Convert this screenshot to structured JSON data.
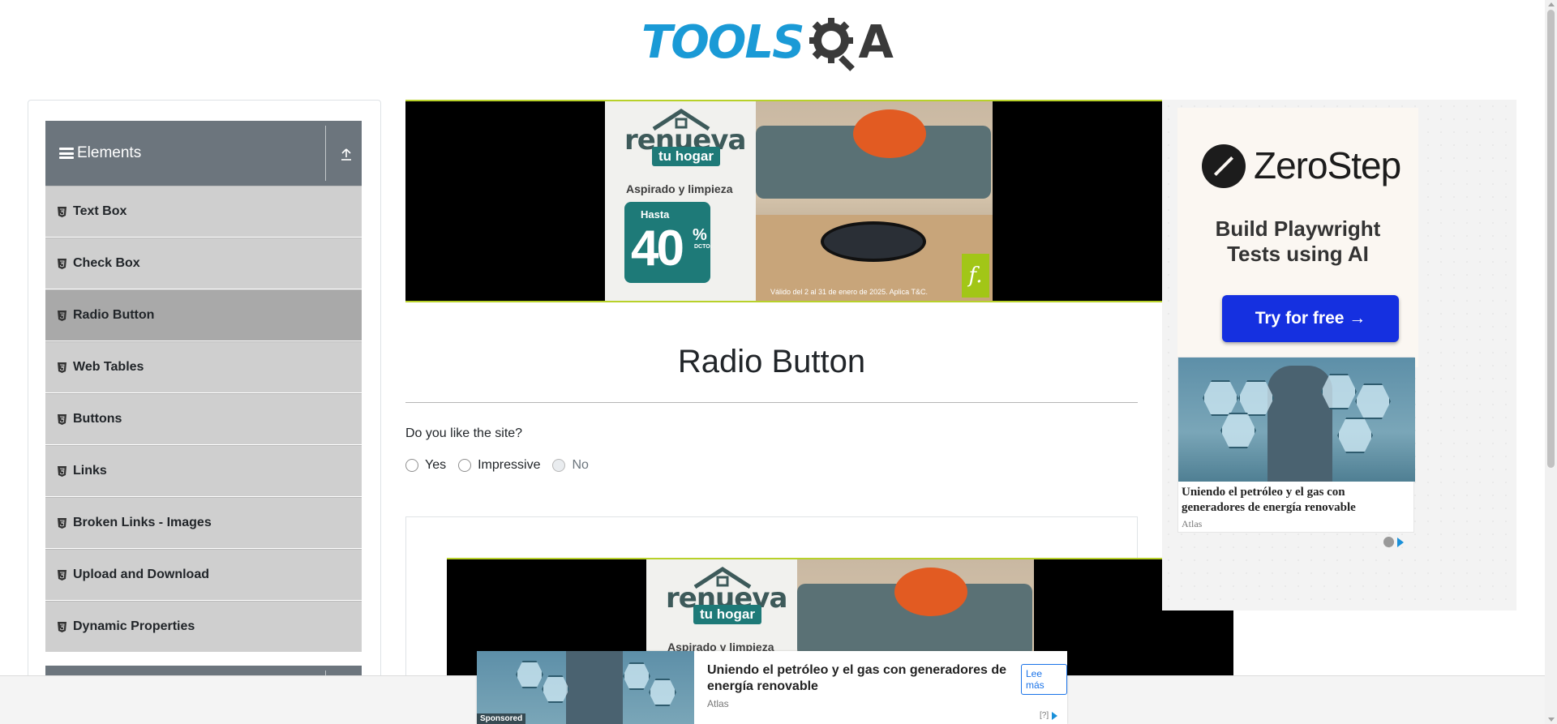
{
  "header": {
    "logo_text_left": "TOOLS",
    "logo_text_right": "A"
  },
  "sidebar": {
    "group_label": "Elements",
    "items": [
      {
        "label": "Text Box",
        "active": false
      },
      {
        "label": "Check Box",
        "active": false
      },
      {
        "label": "Radio Button",
        "active": true
      },
      {
        "label": "Web Tables",
        "active": false
      },
      {
        "label": "Buttons",
        "active": false
      },
      {
        "label": "Links",
        "active": false
      },
      {
        "label": "Broken Links - Images",
        "active": false
      },
      {
        "label": "Upload and Download",
        "active": false
      },
      {
        "label": "Dynamic Properties",
        "active": false
      }
    ]
  },
  "top_ad": {
    "brand_line1": "renueva",
    "brand_line2": "tu hogar",
    "headline": "Aspirado y limpieza",
    "promo_prefix": "Hasta",
    "promo_value": "40",
    "promo_symbol": "%",
    "promo_suffix": "DCTO.",
    "legal": "Válido del 2 al 31 de enero de 2025. Aplica T&C.",
    "logo_letter": "f."
  },
  "main": {
    "title": "Radio Button",
    "question": "Do you like the site?",
    "options": [
      {
        "label": "Yes",
        "disabled": false
      },
      {
        "label": "Impressive",
        "disabled": false
      },
      {
        "label": "No",
        "disabled": true
      }
    ]
  },
  "right_ad": {
    "brand": "ZeroStep",
    "tagline_line1": "Build Playwright",
    "tagline_line2": "Tests using AI",
    "cta": "Try for free →",
    "native_title": "Uniendo el petróleo y el gas con generadores de energía renovable",
    "native_source": "Atlas"
  },
  "sticky_ad": {
    "sponsored": "Sponsored",
    "title": "Uniendo el petróleo y el gas con generadores de energía renovable",
    "source": "Atlas",
    "cta": "Lee más",
    "info": "[?]"
  },
  "colors": {
    "sidebar_header": "#6c757d",
    "menu_item": "#cfcfcf",
    "menu_item_active": "#a9a9a9",
    "logo_blue": "#1a9ad6",
    "ad_accent": "#b8d12a",
    "cta_blue": "#1530e0"
  }
}
